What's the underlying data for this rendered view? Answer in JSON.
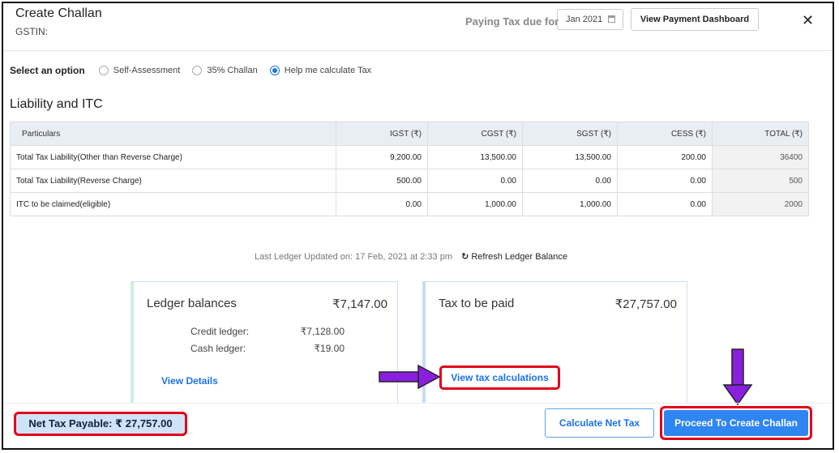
{
  "header": {
    "title": "Create Challan",
    "gstin_label": "GSTIN:",
    "paying_label": "Paying Tax due for",
    "month": "Jan 2021",
    "dashboard_button": "View Payment Dashboard",
    "close_icon": "close-icon"
  },
  "options": {
    "label": "Select an option",
    "items": [
      {
        "label": "Self-Assessment",
        "checked": false
      },
      {
        "label": "35% Challan",
        "checked": false
      },
      {
        "label": "Help me calculate Tax",
        "checked": true
      }
    ]
  },
  "liability": {
    "title": "Liability and ITC",
    "columns": [
      "Particulars",
      "IGST (₹)",
      "CGST (₹)",
      "SGST (₹)",
      "CESS (₹)",
      "TOTAL (₹)"
    ],
    "rows": [
      {
        "particular": "Total Tax Liability(Other than Reverse Charge)",
        "igst": "9,200.00",
        "cgst": "13,500.00",
        "sgst": "13,500.00",
        "cess": "200.00",
        "total": "36400"
      },
      {
        "particular": "Total Tax Liability(Reverse Charge)",
        "igst": "500.00",
        "cgst": "0.00",
        "sgst": "0.00",
        "cess": "0.00",
        "total": "500"
      },
      {
        "particular": "ITC to be claimed(eligible)",
        "igst": "0.00",
        "cgst": "1,000.00",
        "sgst": "1,000.00",
        "cess": "0.00",
        "total": "2000"
      }
    ]
  },
  "ledger_update": {
    "text": "Last Ledger Updated on: 17 Feb, 2021 at 2:33 pm",
    "refresh_label": "Refresh Ledger Balance"
  },
  "ledger_card": {
    "title": "Ledger balances",
    "amount": "₹7,147.00",
    "credit_label": "Credit ledger:",
    "credit_value": "₹7,128.00",
    "cash_label": "Cash ledger:",
    "cash_value": "₹19.00",
    "link": "View Details"
  },
  "tax_card": {
    "title": "Tax to be paid",
    "amount": "₹27,757.00",
    "link": "View tax calculations"
  },
  "footer": {
    "net_tax": "Net Tax Payable: ₹ 27,757.00",
    "calculate_button": "Calculate Net Tax",
    "proceed_button": "Proceed To Create Challan"
  },
  "colors": {
    "accent": "#1a73e8",
    "highlight": "#e0001b",
    "annotation_arrow": "#8a1fe0"
  }
}
